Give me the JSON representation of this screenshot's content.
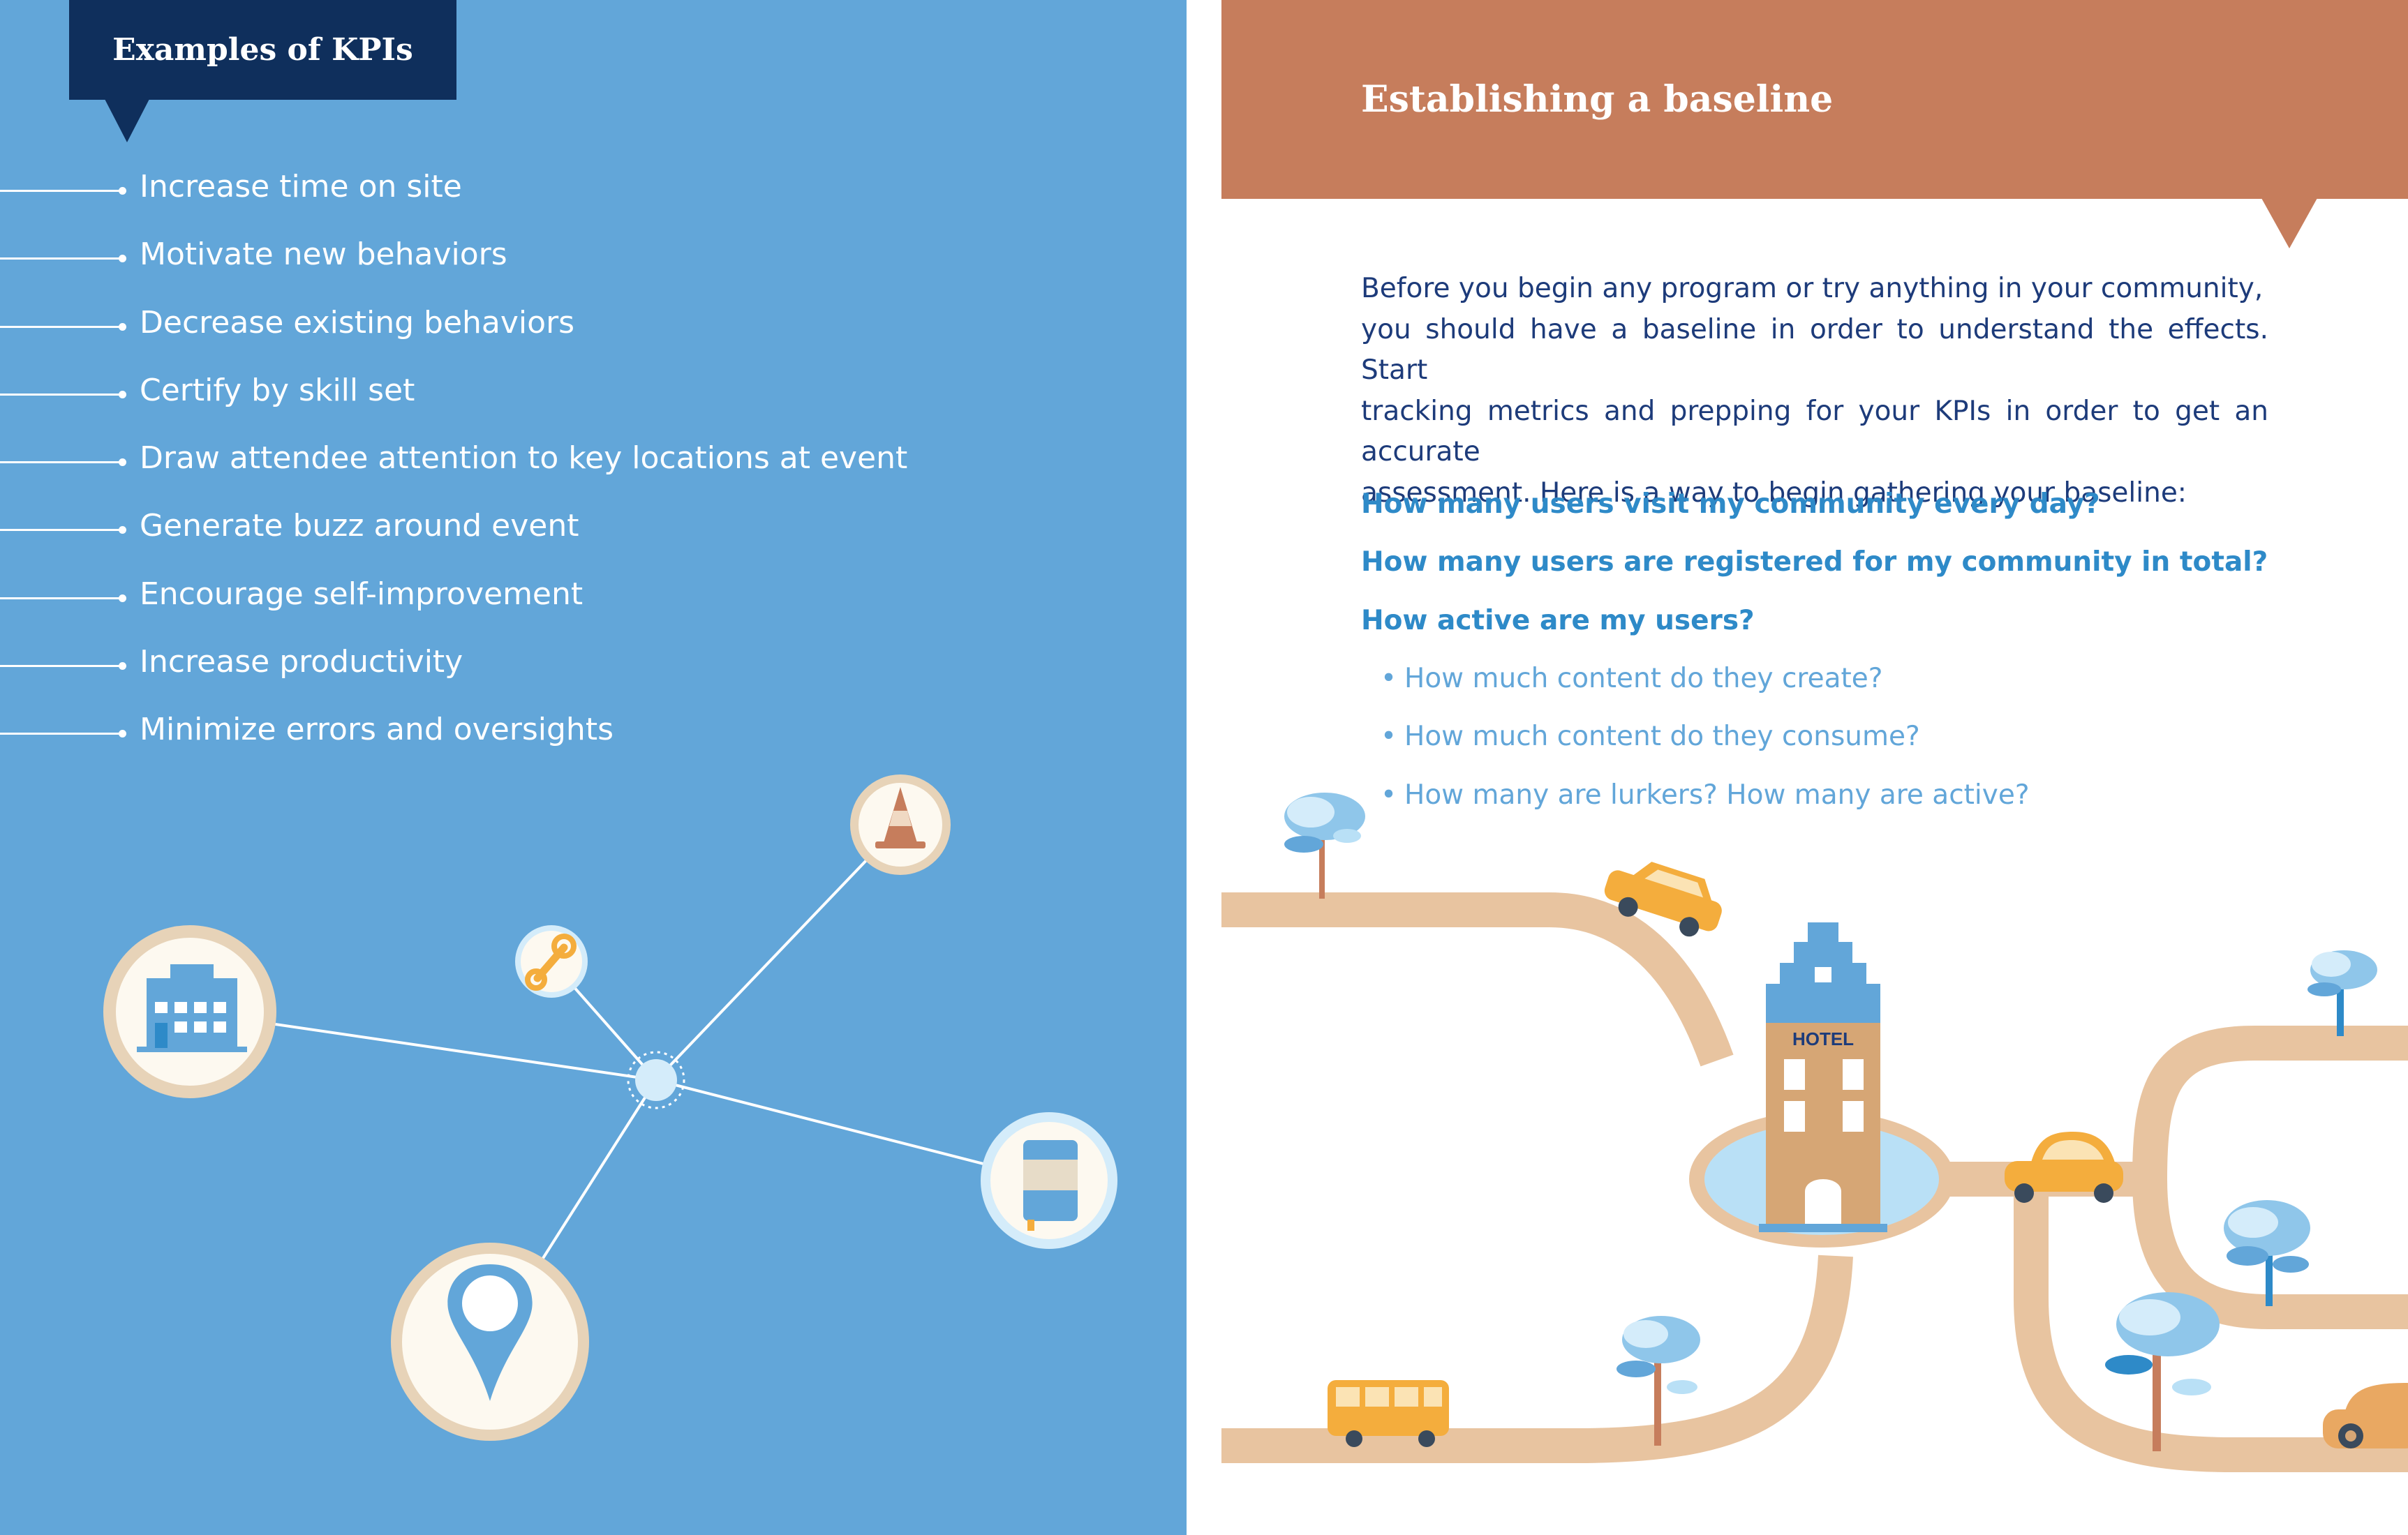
{
  "kpis": {
    "title": "Examples of KPIs",
    "items": [
      "Increase time on site",
      "Motivate new behaviors",
      "Decrease existing behaviors",
      "Certify by skill set",
      "Draw attendee attention to key locations at event",
      "Generate buzz around event",
      "Encourage self-improvement",
      "Increase productivity",
      "Minimize errors and oversights"
    ],
    "network_icons": [
      "building-icon",
      "wrench-icon",
      "traffic-cone-icon",
      "notebook-icon",
      "location-pin-icon"
    ]
  },
  "baseline": {
    "title": "Establishing a baseline",
    "intro_lines": [
      "Before you begin any program or try anything in your community,",
      "you should have a baseline in order to understand the effects. Start",
      "tracking metrics and prepping for your KPIs in order to get an accurate",
      "assessment. Here is a way to begin gathering your baseline:"
    ],
    "questions": [
      "How many users visit my community every day?",
      "How many users are registered for my community in total?",
      "How active are my users?"
    ],
    "sub_questions": [
      "How much content do they create?",
      "How much content do they consume?",
      "How many are lurkers? How many are active?"
    ],
    "bullet_symbol": "•",
    "hotel_sign": "HOTEL"
  },
  "colors": {
    "left_background": "#62a6d9",
    "kpi_tab": "#0f2f5c",
    "baseline_header": "#c67d5c",
    "intro_text": "#1d3b7a",
    "question_text": "#2e8ac8",
    "road": "#e8c4a0",
    "vehicle": "#f4ad3d"
  }
}
